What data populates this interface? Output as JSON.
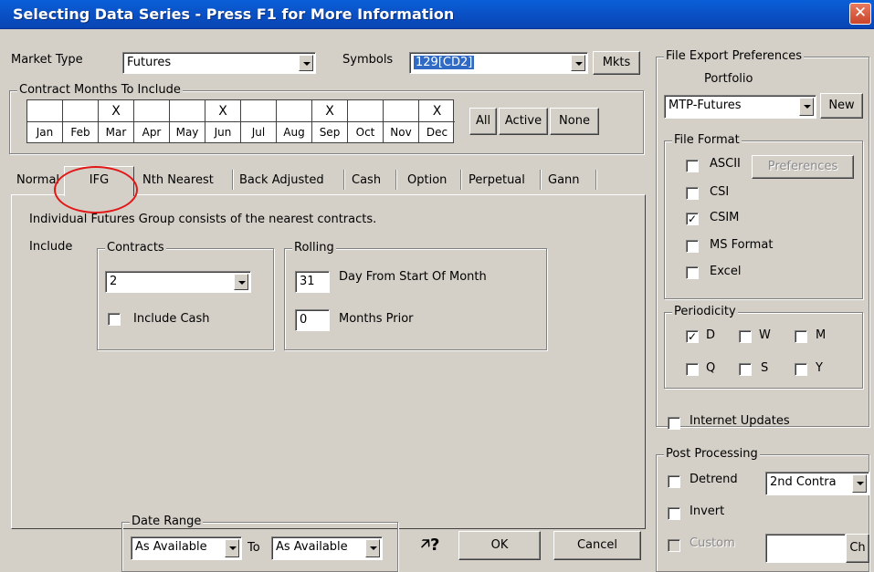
{
  "window": {
    "title": "Selecting Data Series - Press F1 for More Information",
    "close_glyph": "✕"
  },
  "market_type": {
    "label": "Market Type",
    "value": "Futures"
  },
  "symbols": {
    "label": "Symbols",
    "value": "129[CD2]",
    "mkts_label": "Mkts"
  },
  "contract_months": {
    "label": "Contract Months To Include",
    "months": [
      {
        "name": "Jan",
        "selected": ""
      },
      {
        "name": "Feb",
        "selected": ""
      },
      {
        "name": "Mar",
        "selected": "X"
      },
      {
        "name": "Apr",
        "selected": ""
      },
      {
        "name": "May",
        "selected": ""
      },
      {
        "name": "Jun",
        "selected": "X"
      },
      {
        "name": "Jul",
        "selected": ""
      },
      {
        "name": "Aug",
        "selected": ""
      },
      {
        "name": "Sep",
        "selected": "X"
      },
      {
        "name": "Oct",
        "selected": ""
      },
      {
        "name": "Nov",
        "selected": ""
      },
      {
        "name": "Dec",
        "selected": "X"
      }
    ],
    "all_label": "All",
    "active_label": "Active",
    "none_label": "None"
  },
  "tabs": [
    {
      "label": "Normal"
    },
    {
      "label": "IFG"
    },
    {
      "label": "Nth Nearest"
    },
    {
      "label": "Back Adjusted"
    },
    {
      "label": "Cash"
    },
    {
      "label": "Option"
    },
    {
      "label": "Perpetual"
    },
    {
      "label": "Gann"
    }
  ],
  "ifg_panel": {
    "description": "Individual Futures Group consists of the nearest contracts.",
    "include_label": "Include",
    "contracts": {
      "label": "Contracts",
      "value": "2",
      "include_cash_label": "Include Cash",
      "include_cash_checked": ""
    },
    "rolling": {
      "label": "Rolling",
      "day_value": "31",
      "day_label": "Day From Start Of Month",
      "months_value": "0",
      "months_label": "Months Prior"
    }
  },
  "date_range": {
    "label": "Date Range",
    "from_value": "As Available",
    "to_label": "To",
    "to_value": "As Available"
  },
  "help_glyph": "?",
  "ok_label": "OK",
  "cancel_label": "Cancel",
  "export": {
    "label": "File Export Preferences",
    "portfolio_label": "Portfolio",
    "portfolio_value": "MTP-Futures",
    "new_label": "New",
    "file_format": {
      "label": "File Format",
      "preferences_label": "Preferences",
      "options": [
        {
          "label": "ASCII",
          "check": ""
        },
        {
          "label": "CSI",
          "check": ""
        },
        {
          "label": "CSIM",
          "check": "✓"
        },
        {
          "label": "MS Format",
          "check": ""
        },
        {
          "label": "Excel",
          "check": ""
        }
      ]
    },
    "periodicity": {
      "label": "Periodicity",
      "options": [
        {
          "label": "D",
          "check": "✓"
        },
        {
          "label": "W",
          "check": ""
        },
        {
          "label": "M",
          "check": ""
        },
        {
          "label": "Q",
          "check": ""
        },
        {
          "label": "S",
          "check": ""
        },
        {
          "label": "Y",
          "check": ""
        }
      ]
    },
    "internet_updates_label": "Internet Updates",
    "post_processing": {
      "label": "Post Processing",
      "detrend_label": "Detrend",
      "detrend_value": "2nd Contra",
      "invert_label": "Invert",
      "custom_label": "Custom",
      "custom_value": "",
      "ch_label": "Ch"
    }
  },
  "colors": {
    "accent_title": "#0a53c9",
    "highlight_circle": "#e01818",
    "selection": "#316ac5"
  }
}
